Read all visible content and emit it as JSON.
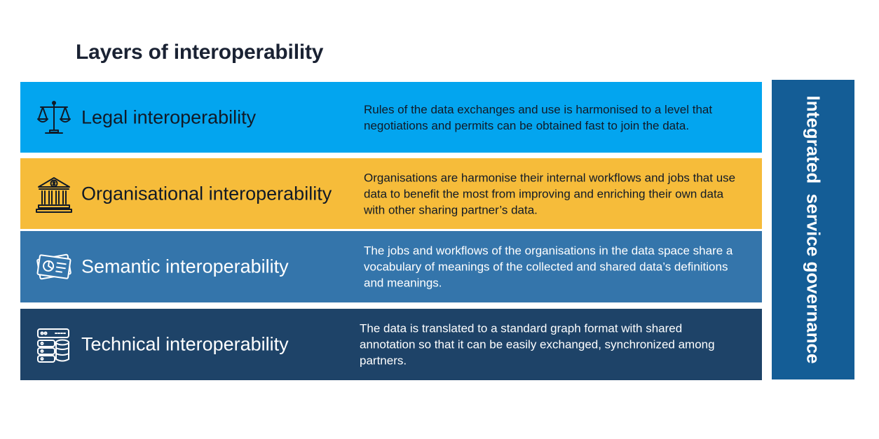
{
  "title": "Layers of interoperability",
  "layers": [
    {
      "name": "Legal interoperability",
      "description": "Rules of the data exchanges and use is harmonised to a level that negotiations and permits can be obtained fast to join the data.",
      "icon": "scales-icon",
      "color": "#03a5ef"
    },
    {
      "name": "Organisational interoperability",
      "description": "Organisations are harmonise their internal workflows and jobs that use data to benefit the most from improving and enriching their own data with other sharing partner’s data.",
      "icon": "bank-icon",
      "color": "#f6bc3a"
    },
    {
      "name": "Semantic interoperability",
      "description": "The jobs and workflows of the organisations in the data space share a vocabulary of meanings of the collected and shared data’s definitions and meanings.",
      "icon": "documents-chart-icon",
      "color": "#3475ab"
    },
    {
      "name": "Technical interoperability",
      "description": "The data is translated to a standard graph format with shared annotation so that it can be easily exchanged, synchronized among partners.",
      "icon": "database-server-icon",
      "color": "#1e4368"
    }
  ],
  "governance": {
    "label": "Integrated  service governance",
    "color": "#145d96"
  }
}
